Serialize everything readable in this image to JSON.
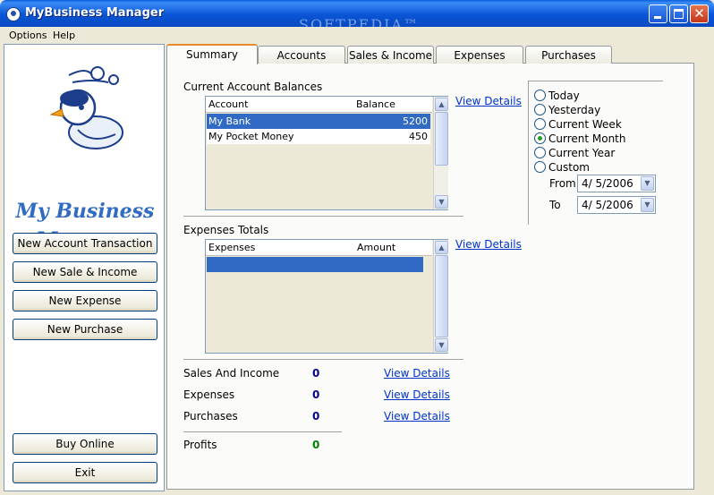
{
  "window": {
    "title": "MyBusiness Manager",
    "watermark": "SOFTPEDIA™"
  },
  "menu": [
    "Options",
    "Help"
  ],
  "sidebar": {
    "logo_line1": "My Business",
    "logo_line2": "Manager",
    "buttons": {
      "new_account_transaction": "New Account Transaction",
      "new_sale_income": "New Sale & Income",
      "new_expense": "New Expense",
      "new_purchase": "New Purchase",
      "buy_online": "Buy Online",
      "exit": "Exit"
    }
  },
  "tabs": [
    "Summary",
    "Accounts",
    "Sales & Income",
    "Expenses",
    "Purchases"
  ],
  "balances": {
    "title": "Current Account Balances",
    "columns": [
      "Account",
      "Balance"
    ],
    "rows": [
      {
        "account": "My Bank",
        "balance": "5200"
      },
      {
        "account": "My Pocket Money",
        "balance": "450"
      }
    ],
    "link": "View Details"
  },
  "expenses_totals": {
    "title": "Expenses Totals",
    "columns": [
      "Expenses",
      "Amount"
    ],
    "link": "View Details"
  },
  "summary": {
    "sales_label": "Sales And Income",
    "sales_value": "0",
    "expenses_label": "Expenses",
    "expenses_value": "0",
    "purchases_label": "Purchases",
    "purchases_value": "0",
    "profits_label": "Profits",
    "profits_value": "0",
    "link": "View Details"
  },
  "period": {
    "options": [
      "Today",
      "Yesterday",
      "Current Week",
      "Current Month",
      "Current Year",
      "Custom"
    ],
    "selected": "Current Month",
    "from_label": "From",
    "from_value": "4/ 5/2006",
    "to_label": "To",
    "to_value": "4/ 5/2006"
  },
  "colors": {
    "selection": "#316ac5",
    "link": "#0033cc",
    "value": "#00008b",
    "profit": "#008000"
  }
}
